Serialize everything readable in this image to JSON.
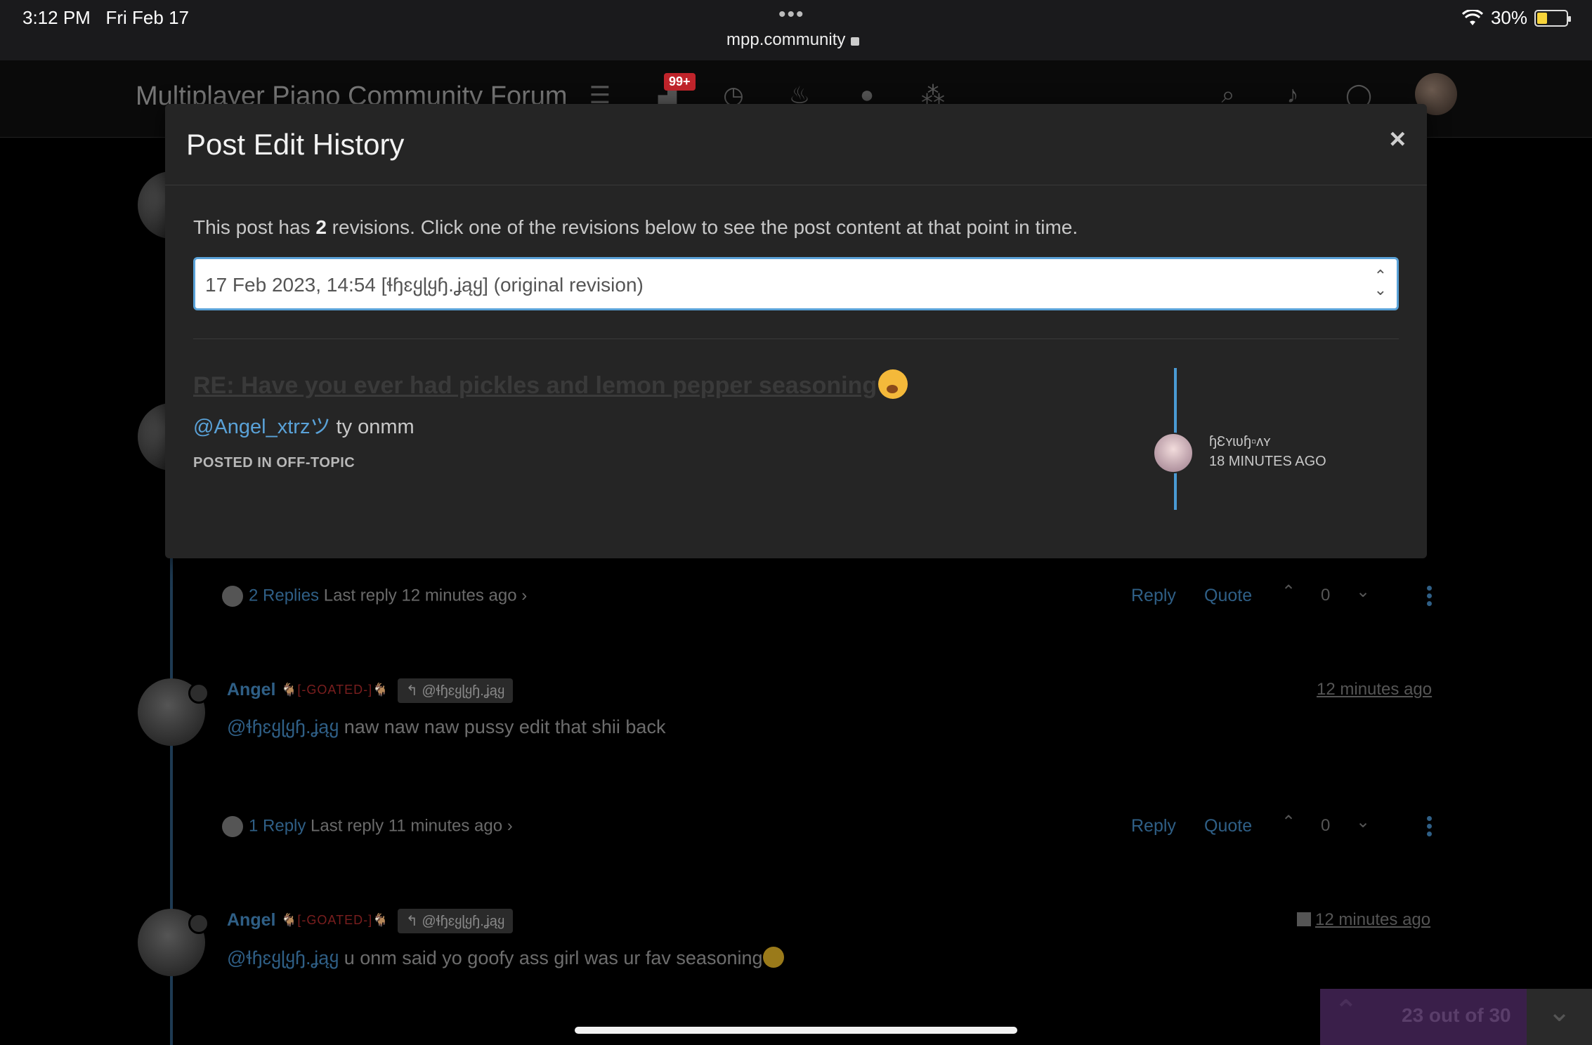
{
  "status": {
    "time": "3:12 PM",
    "date": "Fri Feb 17",
    "url": "mpp.community",
    "battery": "30%",
    "dots": "•••"
  },
  "nav": {
    "title": "Multiplayer Piano Community Forum",
    "badge": "99+"
  },
  "modal": {
    "title": "Post Edit History",
    "close": "×",
    "desc_before": "This post has ",
    "desc_count": "2",
    "desc_after": " revisions. Click one of the revisions below to see the post content at that point in time.",
    "revision_value": "17 Feb 2023, 14:54 [ɬɧɛყɭყɧ.ʝąყ] (original revision)",
    "post_title": "RE: Have you ever had pickles and lemon pepper seasoning",
    "post_mention": "@Angel_xtrzツ",
    "post_text": " ty onmm",
    "posted_in": "POSTED IN OFF-TOPIC",
    "timeline_user": "ɧƐʏɩʋɧ▫ʌʏ",
    "timeline_time": "18 MINUTES AGO"
  },
  "posts": [
    {
      "replies": "2 Replies",
      "last_reply": " Last reply 12 minutes ago ›",
      "reply": "Reply",
      "quote": "Quote",
      "votes": "0"
    },
    {
      "author": "Angel",
      "tag": "🐐[-GOATED-]🐐",
      "reply_to": "↰ @ɬɧɛყɭყɧ.ʝąყ",
      "mention": "@ɬɧɛყɭყɧ.ʝąყ",
      "text": " naw naw naw pussy edit that shii back",
      "time": "12 minutes ago",
      "replies": "1 Reply",
      "last_reply": " Last reply 11 minutes ago ›",
      "reply": "Reply",
      "quote": "Quote",
      "votes": "0"
    },
    {
      "author": "Angel",
      "tag": "🐐[-GOATED-]🐐",
      "reply_to": "↰ @ɬɧɛყɭყɧ.ʝąყ",
      "mention": "@ɬɧɛყɭყɧ.ʝąყ",
      "text": " u onm said yo goofy ass girl was ur fav seasoning",
      "time": "12 minutes ago"
    }
  ],
  "pager": {
    "label": "23 out of 30",
    "up": "⌃",
    "down": "⌄"
  }
}
